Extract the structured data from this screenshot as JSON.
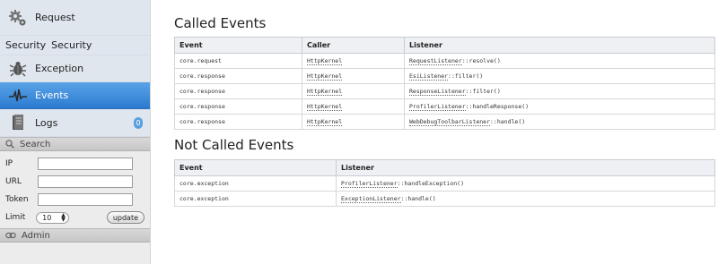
{
  "sidebar": {
    "menu": [
      {
        "label": "Request",
        "icon": "gears-icon"
      },
      {
        "label": "Security",
        "prefix": "Security",
        "icon": ""
      },
      {
        "label": "Exception",
        "icon": "bug-icon"
      },
      {
        "label": "Events",
        "icon": "pulse-icon",
        "selected": true
      },
      {
        "label": "Logs",
        "icon": "log-icon",
        "badge": "0"
      }
    ],
    "search": {
      "header": "Search",
      "ip_label": "IP",
      "ip_value": "",
      "url_label": "URL",
      "url_value": "",
      "token_label": "Token",
      "token_value": "",
      "limit_label": "Limit",
      "limit_value": "10",
      "update_label": "update"
    },
    "admin": {
      "header": "Admin"
    }
  },
  "called": {
    "title": "Called Events",
    "headers": [
      "Event",
      "Caller",
      "Listener"
    ],
    "rows": [
      {
        "event": "core.request",
        "caller": "HttpKernel",
        "listener_class": "RequestListener",
        "listener_method": "::resolve()"
      },
      {
        "event": "core.response",
        "caller": "HttpKernel",
        "listener_class": "EsiListener",
        "listener_method": "::filter()"
      },
      {
        "event": "core.response",
        "caller": "HttpKernel",
        "listener_class": "ResponseListener",
        "listener_method": "::filter()"
      },
      {
        "event": "core.response",
        "caller": "HttpKernel",
        "listener_class": "ProfilerListener",
        "listener_method": "::handleResponse()"
      },
      {
        "event": "core.response",
        "caller": "HttpKernel",
        "listener_class": "WebDebugToolbarListener",
        "listener_method": "::handle()"
      }
    ]
  },
  "not_called": {
    "title": "Not Called Events",
    "headers": [
      "Event",
      "Listener"
    ],
    "rows": [
      {
        "event": "core.exception",
        "listener_class": "ProfilerListener",
        "listener_method": "::handleException()"
      },
      {
        "event": "core.exception",
        "listener_class": "ExceptionListener",
        "listener_method": "::handle()"
      }
    ]
  }
}
